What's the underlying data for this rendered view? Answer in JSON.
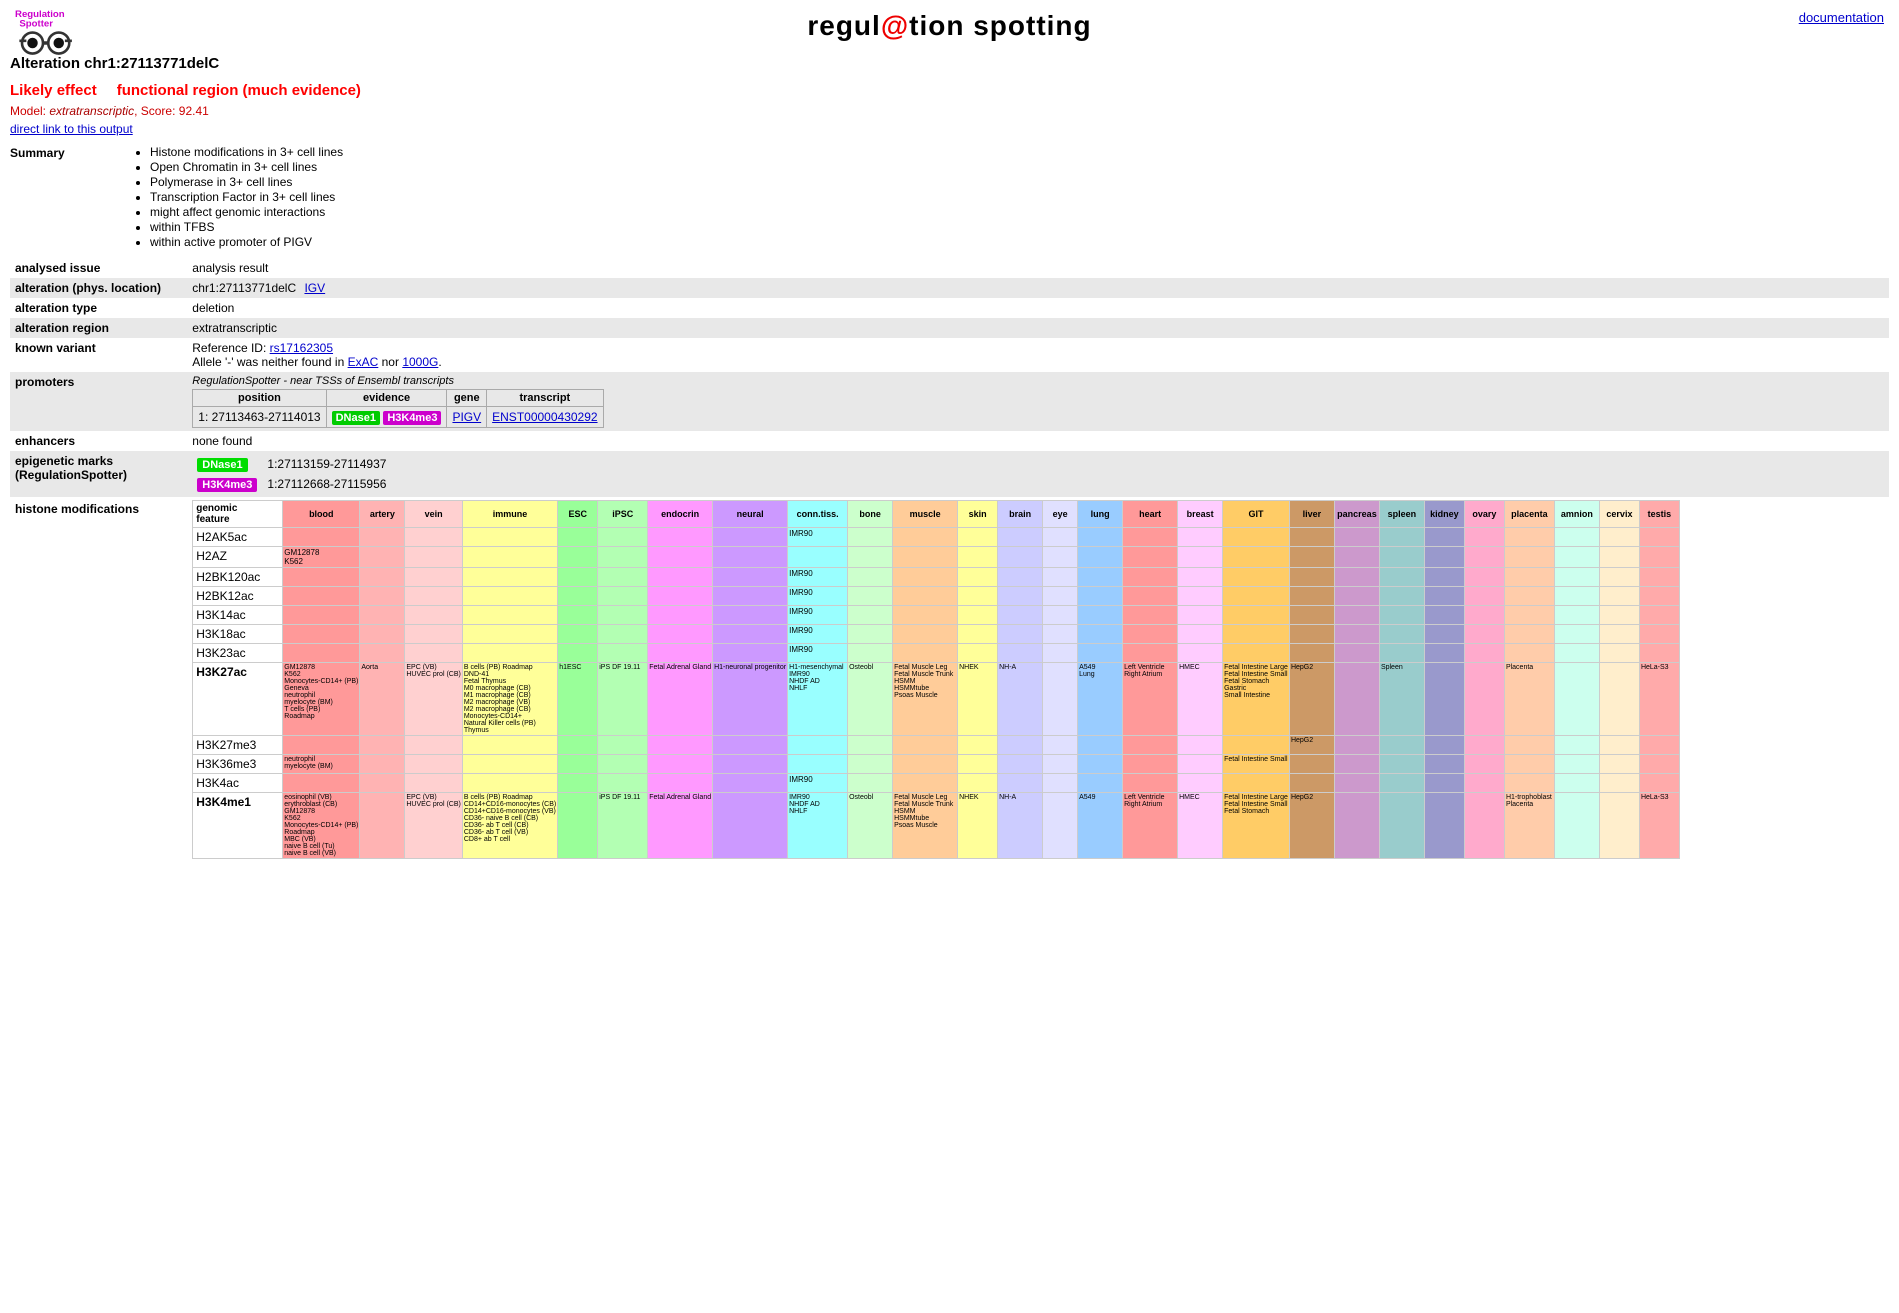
{
  "header": {
    "title_pre": "regul",
    "title_at": "@",
    "title_post": "tion spotting",
    "doc_link": "documentation",
    "logo_alt": "RegulationSpotter logo"
  },
  "alteration": {
    "title": "Alteration chr1:27113771delC"
  },
  "likely_effect": {
    "label": "Likely effect",
    "value": "functional region (much evidence)"
  },
  "model": {
    "label": "Model:",
    "name": "extratranscriptic",
    "score_label": "Score:",
    "score": "92.41"
  },
  "direct_link": {
    "text": "direct link to this output"
  },
  "summary": {
    "label": "Summary",
    "items": [
      "Histone modifications in 3+ cell lines",
      "Open Chromatin in 3+ cell lines",
      "Polymerase in 3+ cell lines",
      "Transcription Factor in 3+ cell lines",
      "might affect genomic interactions",
      "within TFBS",
      "within active promoter of PIGV"
    ]
  },
  "analysis_rows": [
    {
      "label": "analysed issue",
      "value": "analysis result",
      "shaded": false
    },
    {
      "label": "alteration (phys. location)",
      "value": "chr1:27113771delC",
      "igv": "IGV",
      "shaded": true
    },
    {
      "label": "alteration type",
      "value": "deletion",
      "shaded": false
    },
    {
      "label": "alteration region",
      "value": "extratranscriptic",
      "shaded": true
    },
    {
      "label": "known variant",
      "value": "Reference ID: rs17162305\nAllele '-' was neither found in ExAC nor 1000G.",
      "shaded": false
    },
    {
      "label": "promoters",
      "value": "",
      "shaded": true
    },
    {
      "label": "enhancers",
      "value": "none found",
      "shaded": false
    },
    {
      "label": "epigenetic marks\n(RegulationSpotter)",
      "value": "",
      "shaded": true
    }
  ],
  "known_variant": {
    "ref_id_label": "Reference ID:",
    "ref_id_link": "rs17162305",
    "allele_text": "Allele '-' was neither found in",
    "exac_link": "ExAC",
    "nor_text": "nor",
    "thousandg_link": "1000G."
  },
  "promoters": {
    "subtitle": "RegulationSpotter - near TSSs of Ensembl transcripts",
    "cols": [
      "position",
      "evidence",
      "gene",
      "transcript"
    ],
    "rows": [
      {
        "position": "1: 27113463-27114013",
        "evidence_dnase": "DNase1",
        "evidence_h3k": "H3K4me3",
        "gene_link": "PIGV",
        "transcript_link": "ENST00000430292"
      }
    ]
  },
  "epigenetic_marks": {
    "rows": [
      {
        "mark": "DNase1",
        "coords": "1:27113159-27114937"
      },
      {
        "mark": "H3K4me3",
        "coords": "1:27112668-27115956"
      }
    ]
  },
  "histone_modifications": {
    "label": "histone modifications",
    "columns": [
      {
        "id": "genomic_feature",
        "label": "genomic\nfeature",
        "class": ""
      },
      {
        "id": "blood",
        "label": "blood",
        "class": "col-blood"
      },
      {
        "id": "artery",
        "label": "artery",
        "class": "col-artery"
      },
      {
        "id": "vein",
        "label": "vein",
        "class": "col-vein"
      },
      {
        "id": "immune",
        "label": "immune",
        "class": "col-immune"
      },
      {
        "id": "esc",
        "label": "ESC",
        "class": "col-esc"
      },
      {
        "id": "ipsc",
        "label": "iPSC",
        "class": "col-ipsc"
      },
      {
        "id": "endocrin",
        "label": "endocrin",
        "class": "col-endocrin"
      },
      {
        "id": "neural",
        "label": "neural",
        "class": "col-neural"
      },
      {
        "id": "conntiss",
        "label": "conn.tiss.",
        "class": "col-conntiss"
      },
      {
        "id": "bone",
        "label": "bone",
        "class": "col-bone"
      },
      {
        "id": "muscle",
        "label": "muscle",
        "class": "col-muscle"
      },
      {
        "id": "skin",
        "label": "skin",
        "class": "col-skin"
      },
      {
        "id": "brain",
        "label": "brain",
        "class": "col-brain"
      },
      {
        "id": "eye",
        "label": "eye",
        "class": "col-eye"
      },
      {
        "id": "lung",
        "label": "lung",
        "class": "col-lung"
      },
      {
        "id": "heart",
        "label": "heart",
        "class": "col-heart"
      },
      {
        "id": "breast",
        "label": "breast",
        "class": "col-breast"
      },
      {
        "id": "git",
        "label": "GIT",
        "class": "col-git"
      },
      {
        "id": "liver",
        "label": "liver",
        "class": "col-liver"
      },
      {
        "id": "pancreas",
        "label": "pancreas",
        "class": "col-pancreas"
      },
      {
        "id": "spleen",
        "label": "spleen",
        "class": "col-spleen"
      },
      {
        "id": "kidney",
        "label": "kidney",
        "class": "col-kidney"
      },
      {
        "id": "ovary",
        "label": "ovary",
        "class": "col-ovary"
      },
      {
        "id": "placenta",
        "label": "placenta",
        "class": "col-placenta"
      },
      {
        "id": "amnion",
        "label": "amnion",
        "class": "col-amnion"
      },
      {
        "id": "cervix",
        "label": "cervix",
        "class": "col-cervix"
      },
      {
        "id": "testis",
        "label": "testis",
        "class": "col-testis"
      }
    ],
    "marks": [
      {
        "name": "H2AK5ac",
        "bold": false,
        "cells": {
          "conntiss": "IMR90"
        }
      },
      {
        "name": "H2AZ",
        "bold": false,
        "cells": {
          "blood": "GM12878\nK562"
        }
      },
      {
        "name": "H2BK120ac",
        "bold": false,
        "cells": {
          "conntiss": "IMR90"
        }
      },
      {
        "name": "H2BK12ac",
        "bold": false,
        "cells": {
          "conntiss": "IMR90"
        }
      },
      {
        "name": "H3K14ac",
        "bold": false,
        "cells": {
          "conntiss": "IMR90"
        }
      },
      {
        "name": "H3K18ac",
        "bold": false,
        "cells": {
          "conntiss": "IMR90"
        }
      },
      {
        "name": "H3K23ac",
        "bold": false,
        "cells": {
          "conntiss": "IMR90"
        }
      },
      {
        "name": "H3K27ac",
        "bold": true,
        "cells": {
          "blood": "GM12878\nK562\nMonocytes-CD14+ (PB)\nGeneva\nneutrophil\nmyelocyte (BM)\nT cells (PB)\nRoadmap",
          "artery": "Aorta",
          "vein": "EPC (VB)\nHUVEC prol (CB)",
          "immune": "B cells (PB) Roadmap\nDND-41\nFetal Thymus\nM0 macrophage (CB)\nM1 macrophage (CB)\nM2 macrophage (VB)\nM2 macrophage (CB)\nMonocytes-CD14+\nNatural Killer cells (PB)\nThymus",
          "esc": "h1ESC",
          "ipsc": "iPS DF 19.11",
          "endocrin": "Fetal Adrenal Gland",
          "neural": "H1-neuronal progenitor",
          "conntiss": "H1-mesenchymal\nIMR90\nNHDF AD\nNHLF",
          "bone": "Osteobl",
          "muscle": "Fetal Muscle Leg\nFetal Muscle Trunk\nHSMM\nHSMMtube\nPsoas Muscle",
          "skin": "NHEK",
          "brain": "NH-A",
          "lung": "A549\nLung",
          "heart": "Left Ventricle\nRight Atrium",
          "breast": "HMEC",
          "git": "Fetal Intestine Large\nFetal Intestine Small\nFetal Stomach\nGastric\nSmall Intestine",
          "liver": "HepG2",
          "spleen": "Spleen",
          "placenta": "Placenta",
          "testis": "HeLa-S3"
        }
      },
      {
        "name": "H3K27me3",
        "bold": false,
        "cells": {
          "liver": "HepG2"
        }
      },
      {
        "name": "H3K36me3",
        "bold": false,
        "cells": {
          "blood": "neutrophil\nmyelocyte (BM)",
          "git": "Fetal Intestine Small"
        }
      },
      {
        "name": "H3K4ac",
        "bold": false,
        "cells": {
          "conntiss": "IMR90"
        }
      },
      {
        "name": "H3K4me1",
        "bold": true,
        "cells": {
          "blood": "eosinophil (VB)\nerythroblast (CB)\nGM12878\nK562\nMonocytes-CD14+ (PB)\nRoadmap\nMBC (VB)\nnaive B cell (Tu)\nnaive B cell (VB)",
          "vein": "EPC (VB)\nHUVEC prol\n(CB)",
          "immune": "B cells (PB)\nRoadmap\nCD14+CD16-monocytes (CB)\nCD14+CD16-monocytes (VB)\nCD36- naive B cell (CB)\nCD36- ab T cell (CB)\nCD36- ab T cell (VB)\nCD8+ ab T cell",
          "ipsc": "iPS DF 19.11",
          "endocrin": "Fetal Adrenal Gland",
          "conntiss": "IMR90\nNHDF AD\nNHLF",
          "bone": "Osteobl",
          "muscle": "Fetal Muscle Leg\nFetal Muscle Trunk\nHSMM\nHSMMtube\nPsoas Muscle",
          "skin": "NHEK",
          "brain": "NH-A",
          "lung": "A549",
          "heart": "Left Ventricle\nRight Atrium",
          "breast": "HMEC",
          "git": "Fetal Intestine Large\nFetal Intestine Small\nFetal Stomach",
          "liver": "HepG2",
          "placenta": "H1-trophoblast\nPlacenta",
          "testis": "HeLa-S3"
        }
      }
    ]
  }
}
